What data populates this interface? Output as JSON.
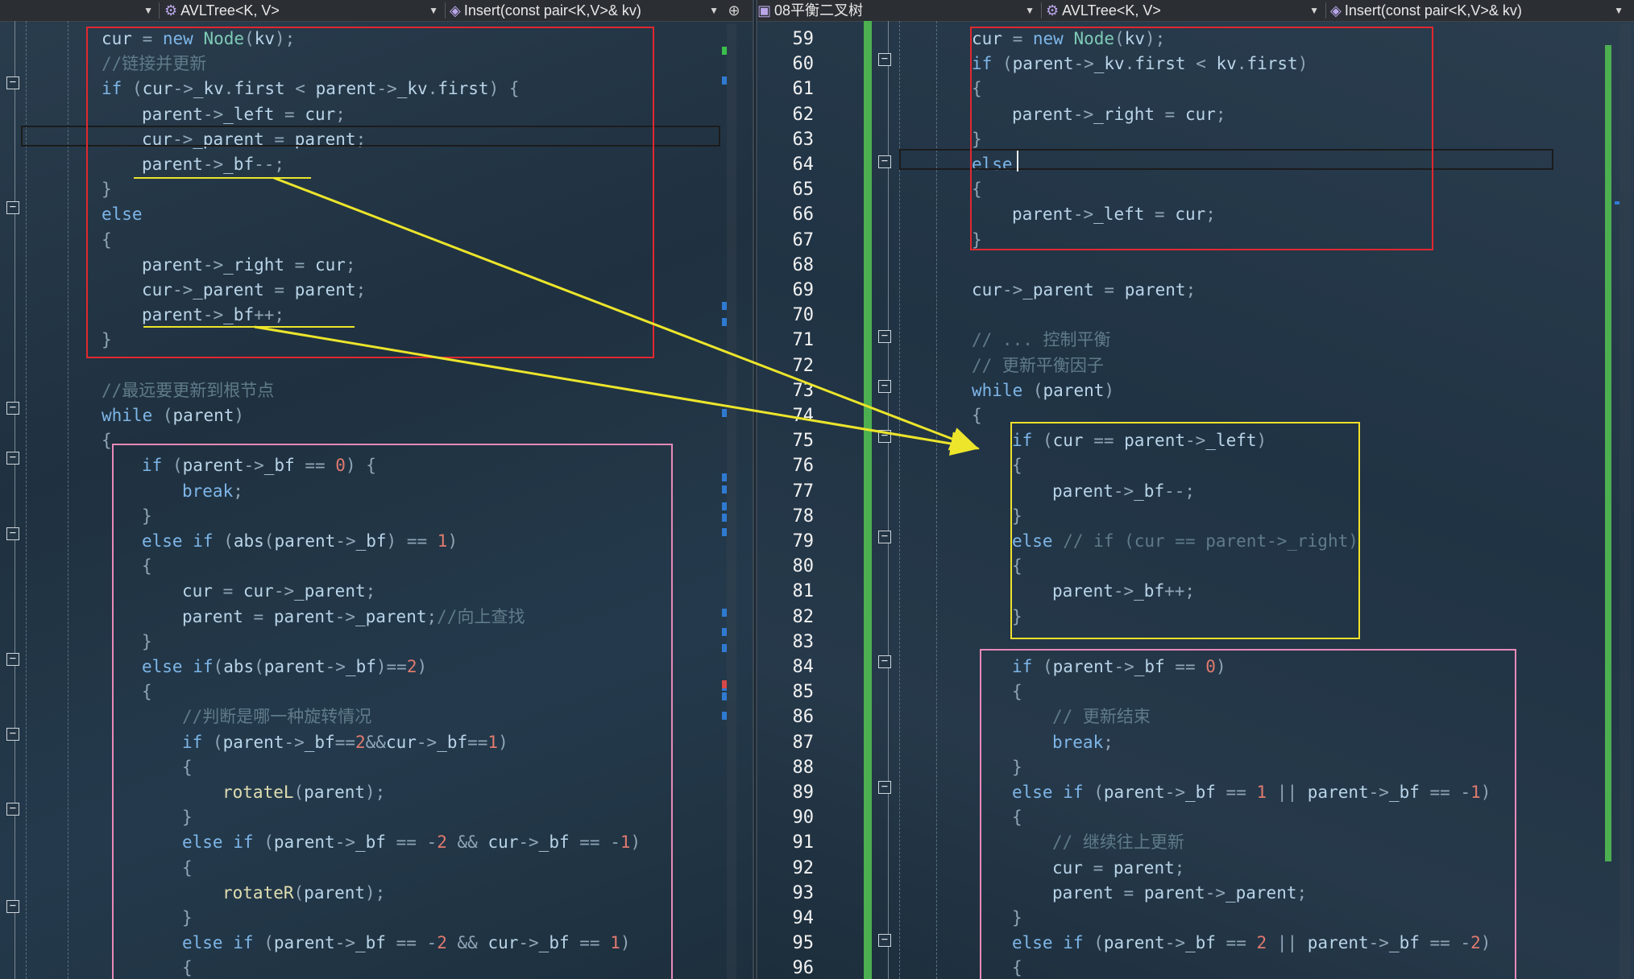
{
  "left_nav": {
    "scope": "",
    "class_name": "AVLTree<K, V>",
    "method_name": "Insert(const pair<K,V>& kv)"
  },
  "right_nav": {
    "file": "08平衡二叉树",
    "class_name": "AVLTree<K, V>",
    "method_name": "Insert(const pair<K,V>& kv)"
  },
  "icons": {
    "class_icon": "class-icon",
    "method_icon": "method-cube-icon",
    "file_icon": "file-icon",
    "dropdown": "chevron-down-icon",
    "split": "split-pin-icon",
    "fold": "fold-minus-icon"
  },
  "colors": {
    "red_box": "#e0282f",
    "pink_box": "#e889b8",
    "yellow_box": "#f0e02a",
    "arrow": "#ece52b",
    "change_bar": "#4caf50"
  },
  "left_code": [
    "cur = new Node(kv);",
    "//链接并更新",
    "if (cur->_kv.first < parent->_kv.first) {",
    "parent->_left = cur;",
    "cur->_parent = parent;",
    "parent->_bf--;",
    "}",
    "else",
    "{",
    "parent->_right = cur;",
    "cur->_parent = parent;",
    "parent->_bf++;",
    "}",
    "",
    "//最远要更新到根节点",
    "while (parent)",
    "{",
    "if (parent->_bf == 0) {",
    "break;",
    "}",
    "else if (abs(parent->_bf) == 1)",
    "{",
    "cur = cur->_parent;",
    "parent = parent->_parent;//向上查找",
    "}",
    "else if(abs(parent->_bf)==2)",
    "{",
    "//判断是哪一种旋转情况",
    "if (parent->_bf==2&&cur->_bf==1)",
    "{",
    "rotateL(parent);",
    "}",
    "else if (parent->_bf == -2 && cur->_bf == -1)",
    "{",
    "rotateR(parent);",
    "}",
    "else if (parent->_bf == -2 && cur->_bf == 1)",
    "{"
  ],
  "right_line_numbers": [
    "59",
    "60",
    "61",
    "62",
    "63",
    "64",
    "65",
    "66",
    "67",
    "68",
    "69",
    "70",
    "71",
    "72",
    "73",
    "74",
    "75",
    "76",
    "77",
    "78",
    "79",
    "80",
    "81",
    "82",
    "83",
    "84",
    "85",
    "86",
    "87",
    "88",
    "89",
    "90",
    "91",
    "92",
    "93",
    "94",
    "95",
    "96"
  ],
  "right_code": [
    "cur = new Node(kv);",
    "if (parent->_kv.first < kv.first)",
    "{",
    "parent->_right = cur;",
    "}",
    "else",
    "{",
    "parent->_left = cur;",
    "}",
    "",
    "cur->_parent = parent;",
    "",
    "// ... 控制平衡",
    "// 更新平衡因子",
    "while (parent)",
    "{",
    "if (cur == parent->_left)",
    "{",
    "parent->_bf--;",
    "}",
    "else // if (cur == parent->_right)",
    "{",
    "parent->_bf++;",
    "}",
    "",
    "if (parent->_bf == 0)",
    "{",
    "// 更新结束",
    "break;",
    "}",
    "else if (parent->_bf == 1 || parent->_bf == -1)",
    "{",
    "// 继续往上更新",
    "cur = parent;",
    "parent = parent->_parent;",
    "}",
    "else if (parent->_bf == 2 || parent->_bf == -2)",
    "{"
  ]
}
